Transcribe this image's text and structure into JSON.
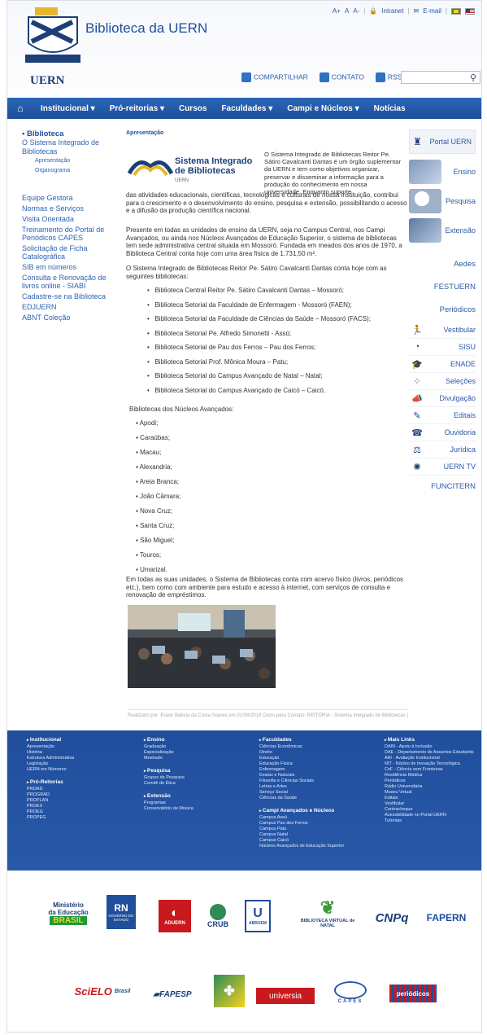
{
  "header": {
    "site_title": "Biblioteca da UERN",
    "univ": "UERN",
    "util": {
      "font_small": "A+",
      "font_normal": "A",
      "font_large": "A-",
      "intranet": "Intranet",
      "email": "E-mail"
    },
    "share": {
      "compartilhar": "COMPARTILHAR",
      "contato": "CONTATO",
      "rss": "RSS"
    },
    "search_placeholder": ""
  },
  "nav": [
    "Institucional ▾",
    "Pró-reitorias ▾",
    "Cursos",
    "Faculdades ▾",
    "Campi e Núcleos ▾",
    "Notícias"
  ],
  "left": {
    "section": "Biblioteca",
    "top_item": "O Sistema Integrado de Bibliotecas",
    "subs": [
      "Apresentação",
      "Organograma"
    ],
    "items": [
      "Equipe Gestora",
      "Normas e Serviços",
      "Visita Orientada",
      "Treinamento do Portal de Periódicos CAPES",
      "Solicitação de Ficha Catalográfica",
      "SIB em números",
      "Consulta e Renovação de livros online - SIABI",
      "Cadastre-se na Biblioteca",
      "EDJUERN",
      "ABNT Coleção"
    ]
  },
  "main": {
    "crumb": "Apresentação",
    "sib_t1": "Sistema Integrado",
    "sib_t2": "de Bibliotecas",
    "sib_t3": "UERN",
    "intro": "O Sistema Integrado de Bibliotecas Reitor Pe. Sátiro Cavalcanti Dantas é um órgão suplementar da UERN e tem como objetivos organizar, preservar e disseminar a informação para a produção do conhecimento em nossa universidade. Enquanto suporte",
    "p1": "das atividades educacionais, científicas, tecnológicas e culturais de nossa instituição, contribui para o crescimento e o desenvolvimento do ensino, pesquisa e extensão, possibilitando o acesso e a difusão da produção científica nacional.",
    "p2": "Presente em todas as unidades de ensino da UERN, seja no Campus Central, nos Campi Avançados, ou ainda nos Núcleos Avançados de Educação Superior, o sistema de bibliotecas tem sede administrativa central situada em Mossoró. Fundada em meados dos anos de 1970, a Biblioteca Central conta hoje com uma área física de 1.731,50 m².",
    "p3": "O Sistema Integrado de Bibliotecas Reitor Pe. Sátiro Cavalcanti Dantas conta hoje com as seguintes bibliotecas:",
    "libraries": [
      "Biblioteca Central Reitor Pe. Sátiro Cavalcanti Dantas – Mossoró;",
      "Biblioteca Setorial da Faculdade de Enfermagem - Mossoró (FAEN);",
      "Biblioteca Setorial da Faculdade de Ciências da Saúde – Mossoró (FACS);",
      "Biblioteca Setorial Pe. Alfredo Simonetti - Assú;",
      "Biblioteca Setorial de Pau dos Ferros – Pau dos Ferros;",
      "Biblioteca Setorial Prof. Mônica Moura – Patu;",
      "Biblioteca Setorial do Campus Avançado de Natal – Natal;",
      "Biblioteca Setorial do Campus Avançado de Caicó – Caicó."
    ],
    "nucleos_header": "Bibliotecas dos Núcleos Avançados:",
    "nucleos": [
      "Apodi;",
      "Caraúbas;",
      "Macau;",
      "Alexandria;",
      "Areia Branca;",
      "João Câmara;",
      "Nova Cruz;",
      "Santa Cruz;",
      "São Miguel;",
      "Touros;",
      "Umarizal."
    ],
    "p4": "Em todas as suas unidades, o Sistema de Bibliotecas conta com acervo físico (livros, periódicos etc.), bem como com ambiente para estudo e acesso à internet, com serviços de consulta e renovação de empréstimos.",
    "footnote": "Realizado por: Eraon Batista da Costa Soares em 01/08/2018 Outro para Contato: REITORIA - Sistema Integrado de Bibliotecas |"
  },
  "right": {
    "portal": "Portal UERN",
    "ensino": "Ensino",
    "pesquisa": "Pesquisa",
    "extensao": "Extensão",
    "text_links": [
      "Aedes",
      "FESTUERN",
      "Periódicos"
    ],
    "small": [
      {
        "icon": "vestibular-icon",
        "label": "Vestibular"
      },
      {
        "icon": "sisu-icon",
        "label": "SISU"
      },
      {
        "icon": "enade-icon",
        "label": "ENADE"
      },
      {
        "icon": "selecoes-icon",
        "label": "Seleções"
      },
      {
        "icon": "divulgacao-icon",
        "label": "Divulgação"
      },
      {
        "icon": "editais-icon",
        "label": "Editais"
      },
      {
        "icon": "ouvidoria-icon",
        "label": "Ouvidoria"
      },
      {
        "icon": "juridica-icon",
        "label": "Jurídica"
      },
      {
        "icon": "uerntv-icon",
        "label": "UERN TV"
      }
    ],
    "funciterm": "FUNCITERN"
  },
  "footer": {
    "c1": {
      "h1": "Institucional",
      "i1": [
        "Apresentação",
        "História",
        "Estrutura Administrativa",
        "Legislação",
        "UERN em Números"
      ],
      "h2": "Pró-Reitorias",
      "i2": [
        "PROAD",
        "PROGRAD",
        "PROPLAN",
        "PROEX",
        "PROEG",
        "PROPEG"
      ]
    },
    "c2": {
      "h1": "Ensino",
      "i1": [
        "Graduação",
        "Especialização",
        "Mestrado"
      ],
      "h2": "Pesquisa",
      "i2": [
        "Grupos de Pesquisa",
        "Comitê de Ética"
      ],
      "h3": "Extensão",
      "i3": [
        "Programas",
        "Conservatório de Música"
      ]
    },
    "c3": {
      "h1": "Faculdades",
      "i1": [
        "Ciências Econômicas",
        "Direito",
        "Educação",
        "Educação Física",
        "Enfermagem",
        "Exatas e Naturais",
        "Filosofia e Ciências Sociais",
        "Letras e Artes",
        "Serviço Social",
        "Ciências da Saúde"
      ],
      "h2": "Campi Avançados e Núcleos",
      "i2": [
        "Campus Assú",
        "Campus Pau dos Ferros",
        "Campus Patu",
        "Campus Natal",
        "Campus Caicó",
        "Núcleos Avançados de Educação Superior"
      ]
    },
    "c4": {
      "h1": "Mais Links",
      "i1": [
        "DAIN - Apoio à Inclusão",
        "DAE - Departamento de Assuntos Estudantis",
        "AAI - Avaliação Institucional",
        "NIT - Núcleo de Inovação Tecnológica",
        "CsF - Ciência sem Fronteiras",
        "Residência Médica",
        "Periódicos",
        "Rádio Universitária",
        "Museu Virtual",
        "Editais",
        "Vestibular",
        "Contracheque",
        "Acessibilidade no Portal UERN",
        "Tutoriais"
      ]
    }
  },
  "partners": {
    "mec_1": "Ministério",
    "mec_2": "da Educação",
    "brasil": "BRASIL",
    "rn": "RN",
    "rn_sub": "GOVERNO DO ESTADO",
    "aduern": "ADUERN",
    "crub": "CRUB",
    "abruem": "ABRUEM",
    "bvn": "BIBLIOTECA VIRTUAL de NATAL",
    "cnpq": "CNPq",
    "fapern": "FAPERN",
    "scielo": "SciELO",
    "scielo_sub": "Brasil",
    "fapesp": "FAPESP",
    "universia": "universia",
    "capes": "CAPES",
    "periodicos": "periódicos"
  }
}
